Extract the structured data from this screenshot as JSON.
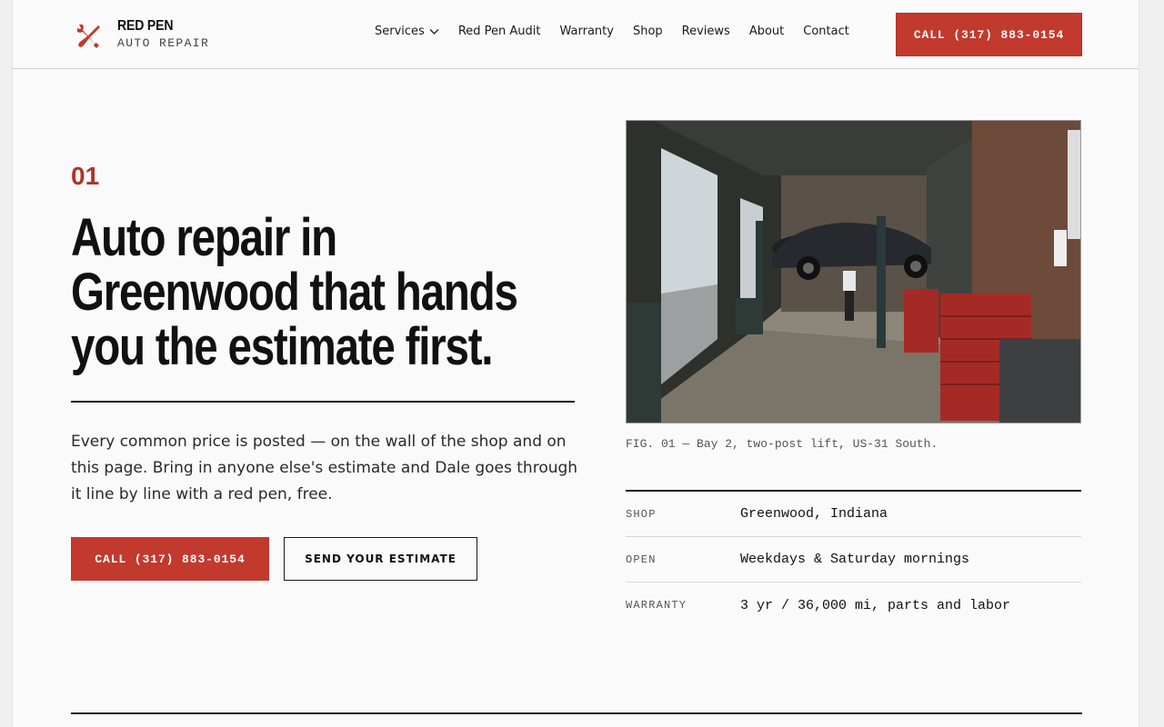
{
  "brand": {
    "name": "RED PEN",
    "subtitle": "AUTO REPAIR",
    "accent_color": "#c2392e"
  },
  "nav": {
    "items": [
      {
        "label": "Services",
        "has_dropdown": true
      },
      {
        "label": "Red Pen Audit"
      },
      {
        "label": "Warranty"
      },
      {
        "label": "Shop"
      },
      {
        "label": "Reviews"
      },
      {
        "label": "About"
      },
      {
        "label": "Contact"
      }
    ],
    "cta_label": "CALL (317) 883-0154"
  },
  "hero": {
    "eyebrow": "01",
    "headline_lines": [
      "Auto repair in",
      "Greenwood that hands",
      "you the estimate first."
    ],
    "lede": "Every common price is posted — on the wall of the shop and on this page. Bring in anyone else's estimate and Dale goes through it line by line with a red pen, free.",
    "primary_button": "CALL (317) 883-0154",
    "secondary_button": "SEND YOUR ESTIMATE"
  },
  "figure": {
    "caption": "FIG. 01 — Bay 2, two-post lift, US-31 South."
  },
  "facts": [
    {
      "label": "SHOP",
      "value": "Greenwood, Indiana"
    },
    {
      "label": "OPEN",
      "value": "Weekdays & Saturday mornings"
    },
    {
      "label": "WARRANTY",
      "value": "3 yr / 36,000 mi, parts and labor"
    }
  ]
}
